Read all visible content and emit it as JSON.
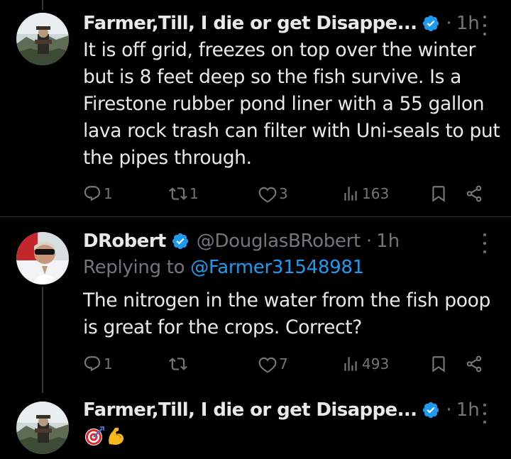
{
  "posts": [
    {
      "author": "Farmer,Till, I die or get Disappe...",
      "time": "1h",
      "text": "It is off grid, freezes on top over the winter but is 8 feet deep so the fish survive. Is a Firestone rubber pond liner with a 55 gallon lava rock trash can filter with Uni-seals to put the pipes through.",
      "replies": "1",
      "reposts": "1",
      "likes": "3",
      "views": "163"
    },
    {
      "author": "DRobert",
      "handle": "@DouglasBRobert",
      "time": "1h",
      "replying_prefix": "Replying to",
      "replying_to": "@Farmer31548981",
      "text": "The nitrogen in the water from the fish poop is great for the crops. Correct?",
      "replies": "1",
      "reposts": "",
      "likes": "7",
      "views": "493"
    },
    {
      "author": "Farmer,Till, I die or get Disappe...",
      "time": "1h",
      "emojis": [
        "direct-hit-emoji",
        "flexed-biceps-emoji"
      ]
    }
  ],
  "colors": {
    "background": "#000000",
    "text": "#e7e9ea",
    "muted": "#71767b",
    "link": "#1d9bf0",
    "verified": "#1d9bf0"
  },
  "separator": "·"
}
